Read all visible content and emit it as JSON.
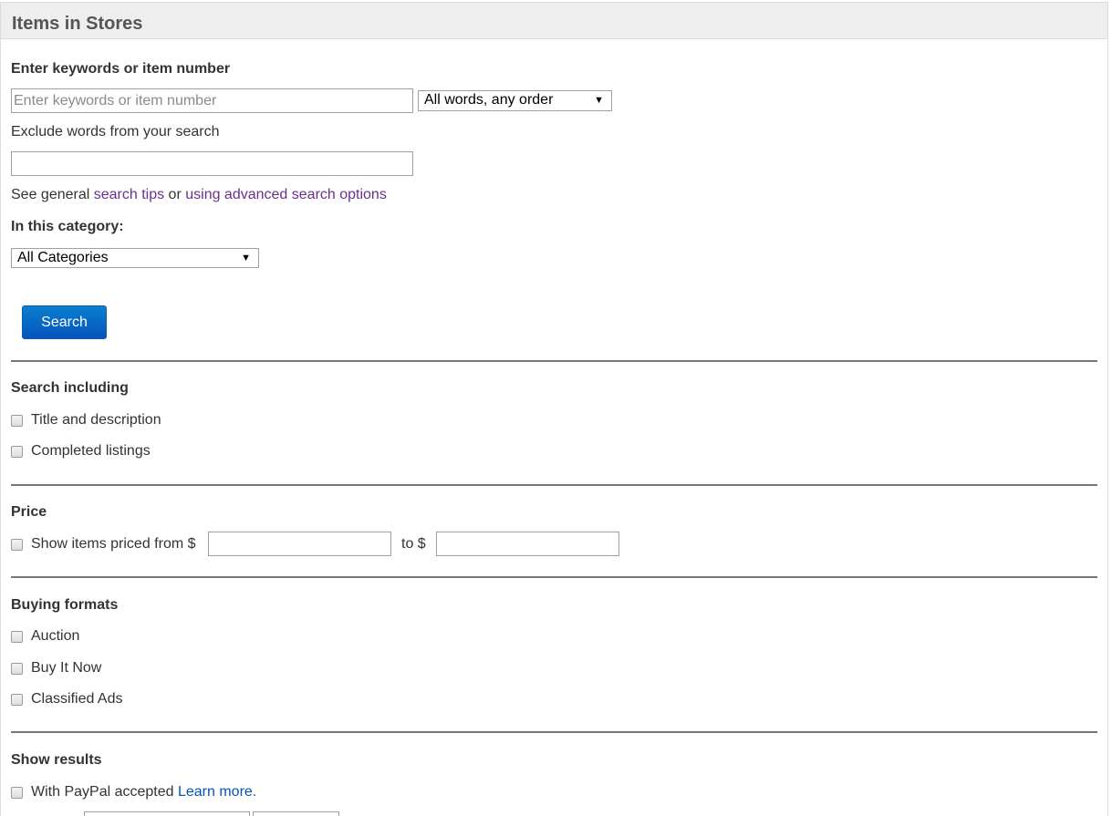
{
  "header": {
    "title": "Items in Stores"
  },
  "keywords": {
    "label": "Enter keywords or item number",
    "placeholder": "Enter keywords or item number",
    "value": "",
    "match_option": "All words, any order"
  },
  "exclude": {
    "label": "Exclude words from your search",
    "value": ""
  },
  "tips": {
    "prefix": "See general ",
    "search_tips": "search tips",
    "middle": " or ",
    "advanced": "using advanced search options"
  },
  "category": {
    "label": "In this category:",
    "selected": "All Categories"
  },
  "search_button": "Search",
  "search_including": {
    "heading": "Search including",
    "options": [
      "Title and description",
      "Completed listings"
    ]
  },
  "price": {
    "heading": "Price",
    "from_label": "Show items priced from $",
    "to_label": "to $",
    "from_value": "",
    "to_value": ""
  },
  "buying_formats": {
    "heading": "Buying formats",
    "options": [
      "Auction",
      "Buy It Now",
      "Classified Ads"
    ]
  },
  "show_results": {
    "heading": "Show results",
    "paypal_label": "With PayPal accepted",
    "learn_more": "Learn more."
  },
  "colors": {
    "link": "#6b2f8f",
    "link_blue": "#0654ba",
    "button": "#0654ba",
    "header_bg": "#eeeeee"
  }
}
